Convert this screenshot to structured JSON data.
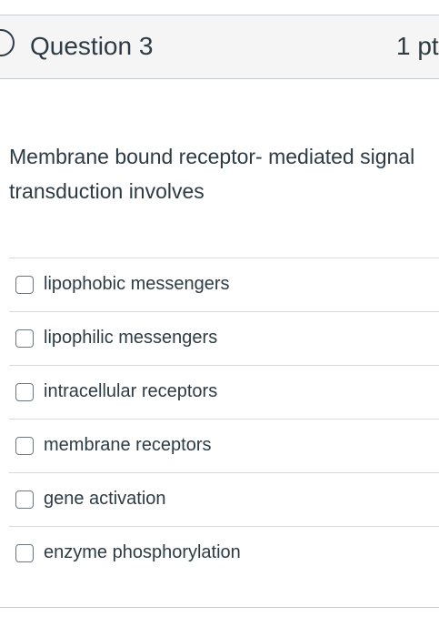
{
  "question": {
    "title": "Question 3",
    "points": "1 pt",
    "text": "Membrane bound receptor- mediated signal transduction involves"
  },
  "answers": [
    {
      "label": "lipophobic messengers"
    },
    {
      "label": "lipophilic messengers"
    },
    {
      "label": "intracellular receptors"
    },
    {
      "label": "membrane receptors"
    },
    {
      "label": "gene activation"
    },
    {
      "label": "enzyme phosphorylation"
    }
  ]
}
